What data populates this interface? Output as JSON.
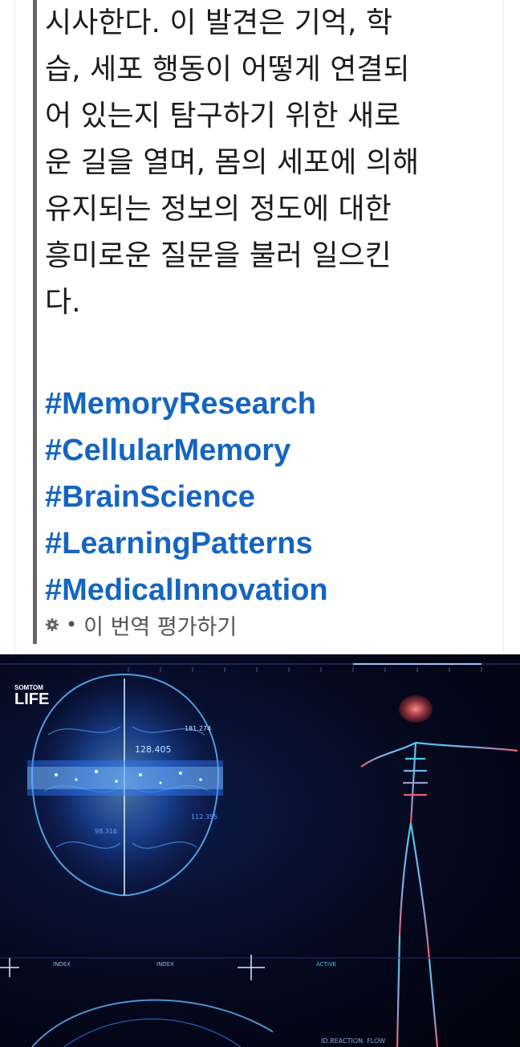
{
  "post": {
    "body_lines": [
      "시사한다. 이 발견은 기억, 학",
      "습, 세포 행동이 어떻게 연결되",
      "어 있는지 탐구하기 위한 새로",
      "운 길을 열며, 몸의 세포에 의해",
      "유지되는 정보의 정도에 대한",
      "흥미로운 질문을 불러 일으킨",
      "다."
    ],
    "hashtags": [
      "#MemoryResearch",
      "#CellularMemory",
      "#BrainScience",
      "#LearningPatterns",
      "#MedicalInnovation"
    ],
    "rate_translation_label": "이 번역 평가하기"
  },
  "media": {
    "logo_top": "SOMTOM",
    "logo_bottom": "LIFE",
    "hud_labels": {
      "index_1": "INDEX",
      "index_2": "INDEX",
      "active": "ACTIVE",
      "reaction_flow": "ID.REACTION. FLOW"
    },
    "brain_readouts": [
      "128.405",
      "181.274",
      "112.355",
      "98.316"
    ]
  },
  "colors": {
    "hashtag": "#1565c0",
    "body_text": "#1c1c1c",
    "quote_bar": "#666666",
    "brain_glow": "#3fa9ff",
    "skeleton": "#58e0ff",
    "head_glow": "#ff5a5a"
  }
}
